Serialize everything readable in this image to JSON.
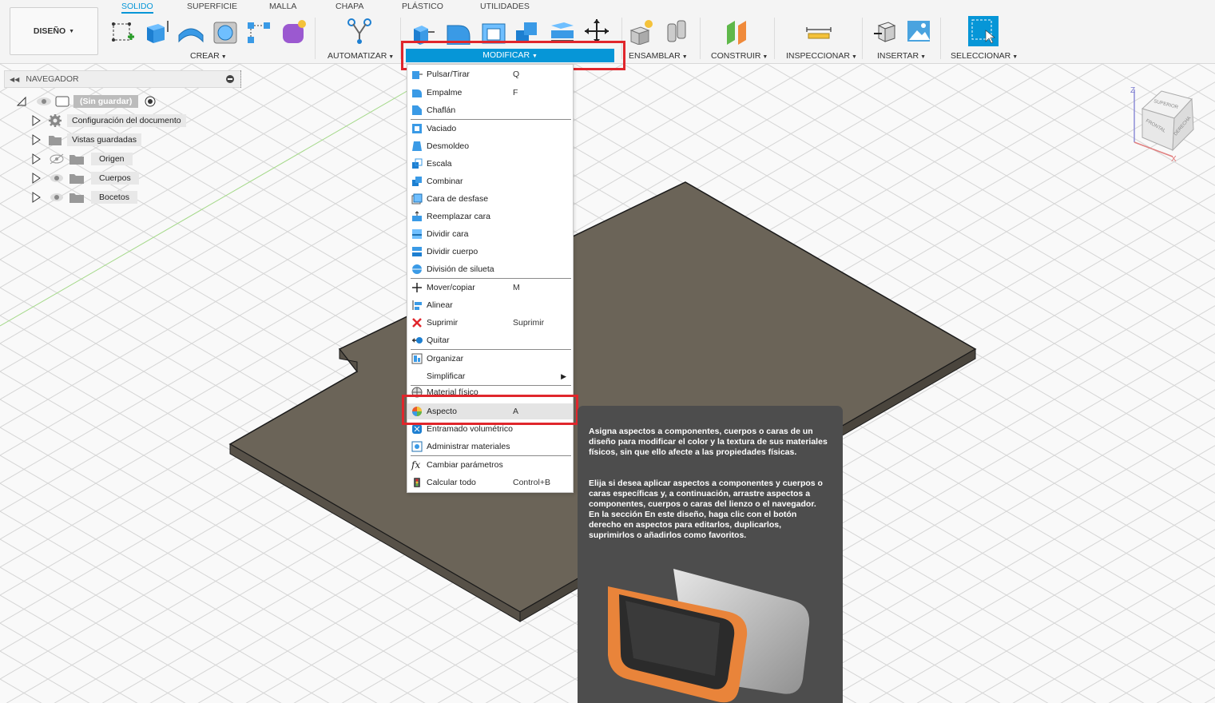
{
  "workspace": {
    "label": "DISEÑO"
  },
  "tabs": [
    {
      "label": "SOLIDO",
      "active": true
    },
    {
      "label": "SUPERFICIE"
    },
    {
      "label": "MALLA"
    },
    {
      "label": "CHAPA"
    },
    {
      "label": "PLÁSTICO"
    },
    {
      "label": "UTILIDADES"
    }
  ],
  "groups": {
    "crear": "CREAR",
    "automatizar": "AUTOMATIZAR",
    "modificar": "MODIFICAR",
    "ensamblar": "ENSAMBLAR",
    "construir": "CONSTRUIR",
    "inspeccionar": "INSPECCIONAR",
    "insertar": "INSERTAR",
    "seleccionar": "SELECCIONAR"
  },
  "navigator": {
    "title": "NAVEGADOR",
    "root": "(Sin guardar)",
    "items": [
      {
        "label": "Configuración del documento"
      },
      {
        "label": "Vistas guardadas"
      },
      {
        "label": "Origen"
      },
      {
        "label": "Cuerpos"
      },
      {
        "label": "Bocetos"
      }
    ]
  },
  "menu": {
    "items": [
      {
        "label": "Pulsar/Tirar",
        "shortcut": "Q",
        "icon": "press-pull-icon"
      },
      {
        "label": "Empalme",
        "shortcut": "F",
        "icon": "fillet-icon"
      },
      {
        "label": "Chaflán",
        "shortcut": "",
        "icon": "chamfer-icon"
      },
      {
        "label": "Vaciado",
        "shortcut": "",
        "icon": "shell-icon"
      },
      {
        "label": "Desmoldeo",
        "shortcut": "",
        "icon": "draft-icon"
      },
      {
        "label": "Escala",
        "shortcut": "",
        "icon": "scale-icon"
      },
      {
        "label": "Combinar",
        "shortcut": "",
        "icon": "combine-icon"
      },
      {
        "label": "Cara de desfase",
        "shortcut": "",
        "icon": "offset-face-icon"
      },
      {
        "label": "Reemplazar cara",
        "shortcut": "",
        "icon": "replace-face-icon"
      },
      {
        "label": "Dividir cara",
        "shortcut": "",
        "icon": "split-face-icon"
      },
      {
        "label": "Dividir cuerpo",
        "shortcut": "",
        "icon": "split-body-icon"
      },
      {
        "label": "División de silueta",
        "shortcut": "",
        "icon": "silhouette-split-icon"
      },
      {
        "label": "Mover/copiar",
        "shortcut": "M",
        "icon": "move-icon"
      },
      {
        "label": "Alinear",
        "shortcut": "",
        "icon": "align-icon"
      },
      {
        "label": "Suprimir",
        "shortcut": "Suprimir",
        "icon": "delete-icon"
      },
      {
        "label": "Quitar",
        "shortcut": "",
        "icon": "remove-icon"
      },
      {
        "label": "Organizar",
        "shortcut": "",
        "icon": "arrange-icon"
      },
      {
        "label": "Simplificar",
        "shortcut": "",
        "icon": "simplify-icon"
      },
      {
        "label": "Material físico",
        "shortcut": "",
        "icon": "physical-material-icon"
      },
      {
        "label": "Aspecto",
        "shortcut": "A",
        "icon": "appearance-icon"
      },
      {
        "label": "Entramado volumétrico",
        "shortcut": "",
        "icon": "volumetric-lattice-icon"
      },
      {
        "label": "Administrar materiales",
        "shortcut": "",
        "icon": "manage-materials-icon"
      },
      {
        "label": "Cambiar parámetros",
        "shortcut": "",
        "icon": "change-parameters-icon"
      },
      {
        "label": "Calcular todo",
        "shortcut": "Control+B",
        "icon": "compute-all-icon"
      }
    ]
  },
  "tooltip": {
    "p1": "Asigna aspectos a componentes, cuerpos o caras de un diseño para modificar el color y la textura de sus materiales físicos, sin que ello afecte a las propiedades físicas.",
    "p2": "Elija si desea aplicar aspectos a componentes y cuerpos o caras específicas y, a continuación, arrastre aspectos a componentes, cuerpos o caras del lienzo o el navegador. En la sección En este diseño, haga clic con el botón derecho en aspectos para editarlos, duplicarlos, suprimirlos o añadirlos como favoritos."
  },
  "viewcube": {
    "top": "SUPERIOR",
    "front": "FRONTAL",
    "right": "DERECHA",
    "axis_z": "Z",
    "axis_x": "X"
  },
  "colors": {
    "accent": "#0696d7",
    "highlight": "#e0262c",
    "plate": "#6b6458"
  }
}
